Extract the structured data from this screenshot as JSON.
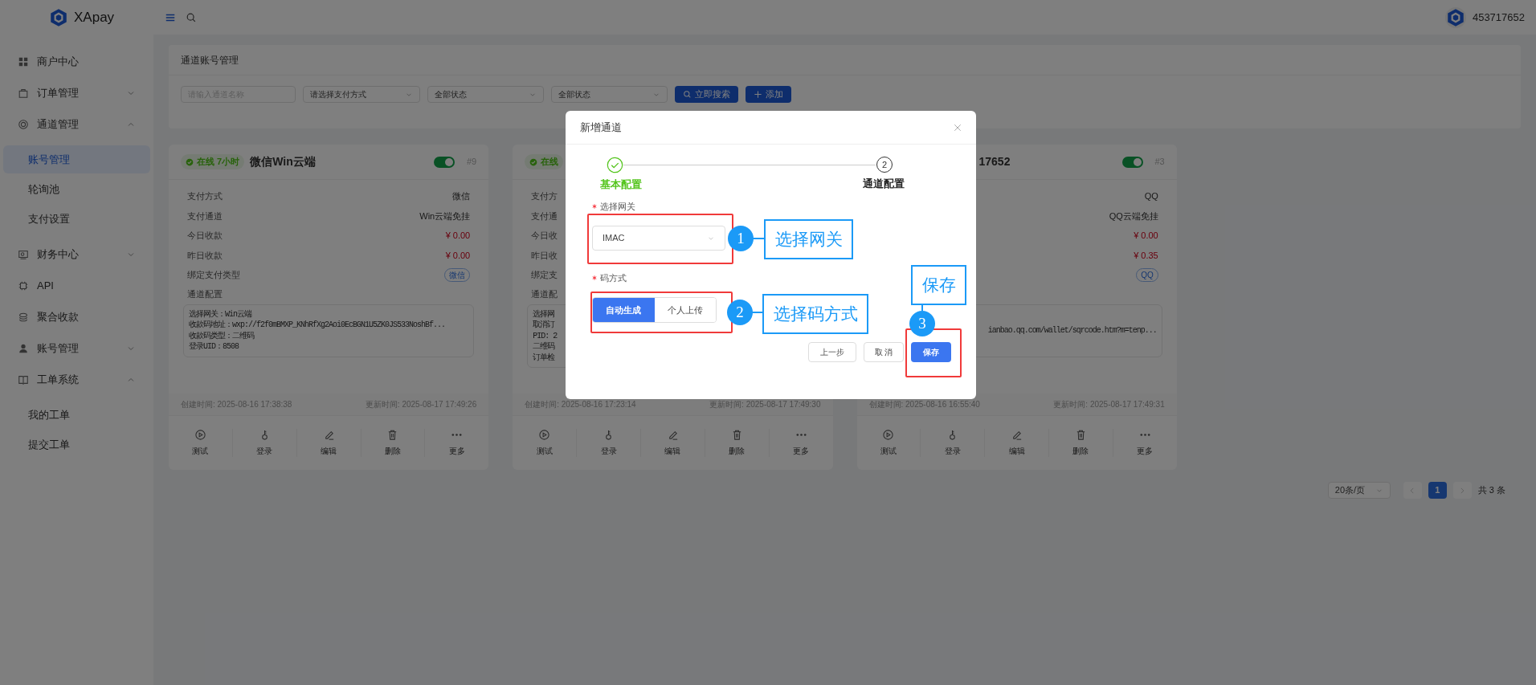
{
  "topbar": {
    "brand": "XApay",
    "user": "453717652"
  },
  "sidebar": {
    "items": [
      {
        "label": "商户中心",
        "selected": false
      },
      {
        "label": "订单管理",
        "selected": false,
        "expanded": false
      },
      {
        "label": "通道管理",
        "selected": false,
        "expanded": true,
        "children": [
          {
            "label": "账号管理",
            "selected": true
          },
          {
            "label": "轮询池",
            "selected": false
          },
          {
            "label": "支付设置",
            "selected": false
          }
        ]
      },
      {
        "label": "财务中心",
        "selected": false,
        "expanded": false
      },
      {
        "label": "API",
        "selected": false
      },
      {
        "label": "聚合收款",
        "selected": false
      },
      {
        "label": "账号管理",
        "selected": false,
        "expanded": false
      },
      {
        "label": "工单系统",
        "selected": false,
        "expanded": true,
        "children": [
          {
            "label": "我的工单",
            "selected": false
          },
          {
            "label": "提交工单",
            "selected": false
          }
        ]
      }
    ]
  },
  "panel": {
    "title": "通道账号管理",
    "filters": [
      {
        "kind": "input",
        "placeholder": "请输入通道名称"
      },
      {
        "kind": "select",
        "value": "请选择支付方式"
      },
      {
        "kind": "select",
        "value": "全部状态"
      },
      {
        "kind": "select",
        "value": "全部状态"
      }
    ],
    "buttons": [
      {
        "kind": "search",
        "label": "立即搜索"
      },
      {
        "kind": "add",
        "label": "添加"
      }
    ]
  },
  "cards": [
    {
      "status": "在线 7小时",
      "title": "微信Win云端",
      "enabled": true,
      "number": "#9",
      "rows": [
        {
          "label": "支付方式",
          "value": "微信",
          "kind": "text"
        },
        {
          "label": "支付通道",
          "value": "Win云端免挂",
          "kind": "text"
        },
        {
          "label": "今日收款",
          "value": "¥ 0.00",
          "kind": "money"
        },
        {
          "label": "昨日收款",
          "value": "¥ 0.00",
          "kind": "money"
        },
        {
          "label": "绑定支付类型",
          "value": "微信",
          "kind": "tag"
        }
      ],
      "config_label": "通道配置",
      "config_lines": [
        "选择网关：Win云端",
        "收款码地址：wxp://f2f0mBMXP_KNhRfXg2Aoi0EcBGN1U5ZK0JS533NoshBf...",
        "收款码类型：二维码",
        "登录UID：8508"
      ],
      "created": "创建时间: 2025-08-16 17:38:38",
      "updated": "更新时间: 2025-08-17 17:49:26",
      "actions": [
        "测试",
        "登录",
        "编辑",
        "删除",
        "更多"
      ]
    },
    {
      "status": "在线",
      "rows": [
        {
          "label": "支付方"
        },
        {
          "label": "支付通"
        },
        {
          "label": "今日收"
        },
        {
          "label": "昨日收"
        },
        {
          "label": "绑定支"
        }
      ],
      "config_label": "通道配",
      "config_lines": [
        "选择网",
        "取消订",
        "PID: 2",
        "二维码",
        "订单检"
      ],
      "created": "创建时间: 2025-08-16 17:23:14",
      "updated": "更新时间: 2025-08-17 17:49:30",
      "actions": [
        "测试",
        "登录",
        "编辑",
        "删除",
        "更多"
      ]
    },
    {
      "title": "17652",
      "enabled": true,
      "number": "#3",
      "rows": [
        {
          "value": "QQ",
          "kind": "text"
        },
        {
          "value": "QQ云端免挂",
          "kind": "text"
        },
        {
          "value": "¥ 0.00",
          "kind": "money"
        },
        {
          "value": "¥ 0.35",
          "kind": "money"
        },
        {
          "value": "QQ",
          "kind": "tag"
        }
      ],
      "config_lines": [
        "ianbao.qq.com/wallet/sqrcode.htm?m=tenp..."
      ],
      "created": "创建时间: 2025-08-16 16:55:40",
      "updated": "更新时间: 2025-08-17 17:49:31",
      "actions": [
        "测试",
        "登录",
        "编辑",
        "删除",
        "更多"
      ]
    }
  ],
  "pagination": {
    "page_size": "20条/页",
    "pages": [
      {
        "label": "1",
        "selected": true
      }
    ],
    "total": "共 3 条"
  },
  "dialog": {
    "title": "新增通道",
    "steps": [
      {
        "label": "基本配置",
        "done": true
      },
      {
        "label": "通道配置",
        "number": "2",
        "done": false
      }
    ],
    "fields": [
      {
        "kind": "select",
        "label": "选择网关",
        "required": true,
        "value": "IMAC"
      },
      {
        "kind": "segmented",
        "label": "码方式",
        "required": true,
        "options": [
          {
            "label": "自动生成",
            "selected": true
          },
          {
            "label": "个人上传",
            "selected": false
          }
        ]
      }
    ],
    "buttons": [
      {
        "label": "上一步",
        "primary": false
      },
      {
        "label": "取 消",
        "primary": false
      },
      {
        "label": "保存",
        "primary": true
      }
    ]
  },
  "annotations": [
    {
      "number": "1",
      "label": "选择网关"
    },
    {
      "number": "2",
      "label": "选择码方式"
    },
    {
      "number": "3",
      "label": "保存"
    }
  ]
}
